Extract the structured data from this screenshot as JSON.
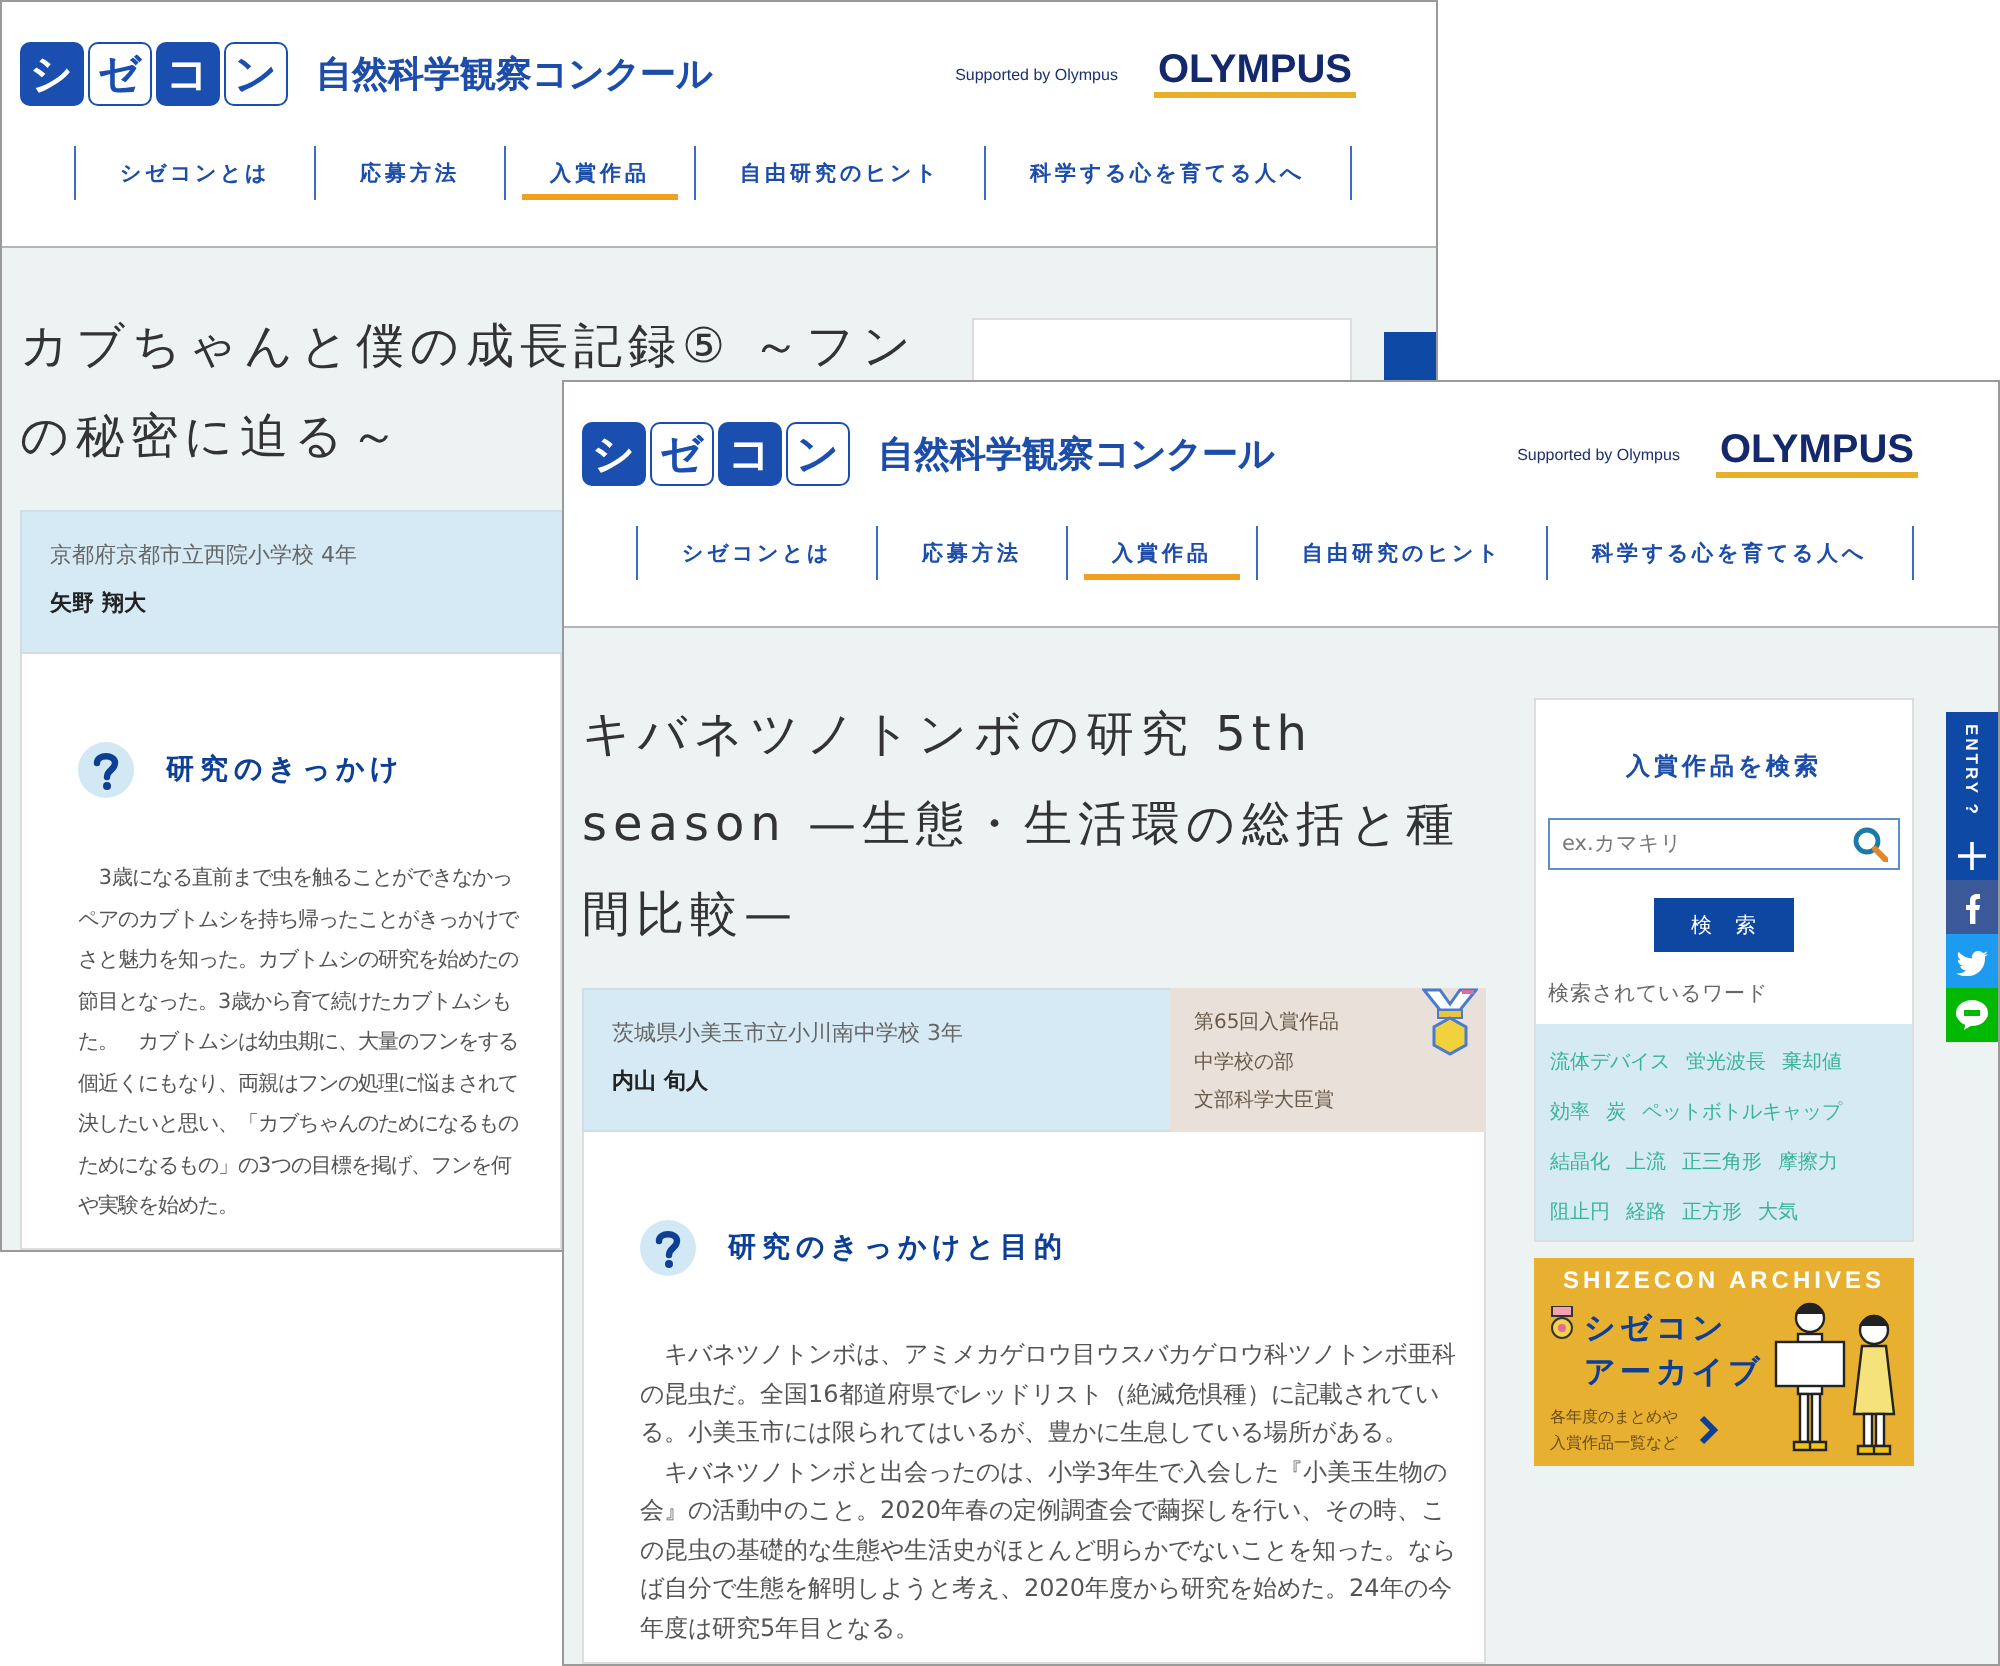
{
  "back_window": {
    "header": {
      "logo_boxes": [
        {
          "char": "シ",
          "filled": true
        },
        {
          "char": "ゼ",
          "filled": false
        },
        {
          "char": "コ",
          "filled": true
        },
        {
          "char": "ン",
          "filled": false
        }
      ],
      "site_name": "自然科学観察コンクール",
      "supported_by": "Supported by Olympus",
      "sponsor_logo": "OLYMPUS"
    },
    "nav": [
      {
        "label": "シゼコンとは",
        "selected": false
      },
      {
        "label": "応募方法",
        "selected": false
      },
      {
        "label": "入賞作品",
        "selected": true
      },
      {
        "label": "自由研究のヒント",
        "selected": false
      },
      {
        "label": "科学する心を育てる人へ",
        "selected": false
      }
    ],
    "title_lines": [
      "カブちゃんと僕の成長記録⑤ ～フン",
      "の秘密に迫る～"
    ],
    "student": {
      "school": "京都府京都市立西院小学校 4年",
      "name": "矢野 翔大"
    },
    "section": {
      "heading": "研究のきっかけ",
      "lines": [
        "3歳になる直前まで虫を触ることができなかっ",
        "ペアのカブトムシを持ち帰ったことがきっかけで",
        "さと魅力を知った。カブトムシの研究を始めたの",
        "節目となった。3歳から育て続けたカブトムシも",
        "た。　カブトムシは幼虫期に、大量のフンをする",
        "個近くにもなり、両親はフンの処理に悩まされて",
        "決したいと思い、「カブちゃんのためになるもの",
        "ためになるもの」の3つの目標を掲げ、フンを何",
        "や実験を始めた。"
      ]
    }
  },
  "front_window": {
    "header": {
      "logo_boxes": [
        {
          "char": "シ",
          "filled": true
        },
        {
          "char": "ゼ",
          "filled": false
        },
        {
          "char": "コ",
          "filled": true
        },
        {
          "char": "ン",
          "filled": false
        }
      ],
      "site_name": "自然科学観察コンクール",
      "supported_by": "Supported by Olympus",
      "sponsor_logo": "OLYMPUS"
    },
    "nav": [
      {
        "label": "シゼコンとは",
        "selected": false
      },
      {
        "label": "応募方法",
        "selected": false
      },
      {
        "label": "入賞作品",
        "selected": true
      },
      {
        "label": "自由研究のヒント",
        "selected": false
      },
      {
        "label": "科学する心を育てる人へ",
        "selected": false
      }
    ],
    "title_lines": [
      "キバネツノトンボの研究 5th",
      "season —生態・生活環の総括と種",
      "間比較—"
    ],
    "student": {
      "school": "茨城県小美玉市立小川南中学校 3年",
      "name": "内山 旬人"
    },
    "award": {
      "lines": [
        "第65回入賞作品",
        "中学校の部",
        "文部科学大臣賞"
      ]
    },
    "section": {
      "heading": "研究のきっかけと目的",
      "paragraphs": [
        "キバネツノトンボは、アミメカゲロウ目ウスバカゲロウ科ツノトンボ亜科の昆虫だ。全国16都道府県でレッドリスト（絶滅危惧種）に記載されている。小美玉市には限られてはいるが、豊かに生息している場所がある。",
        "キバネツノトンボと出会ったのは、小学3年生で入会した『小美玉生物の会』の活動中のこと。2020年春の定例調査会で繭探しを行い、その時、この昆虫の基礎的な生態や生活史がほとんど明らかでないことを知った。ならば自分で生態を解明しようと考え、2020年度から研究を始めた。24年の今年度は研究5年目となる。"
      ]
    },
    "sidebar": {
      "search_title": "入賞作品を検索",
      "search": {
        "placeholder": "ex.カマキリ"
      },
      "search_button": "検　索",
      "words_label": "検索されているワード",
      "words": [
        "流体デバイス",
        "蛍光波長",
        "棄却値",
        "効率",
        "炭",
        "ペットボトルキャップ",
        "結晶化",
        "上流",
        "正三角形",
        "摩擦力",
        "阻止円",
        "経路",
        "正方形",
        "大気"
      ],
      "archive": {
        "heading": "SHIZECON ARCHIVES",
        "title_lines": [
          "シゼコン",
          "アーカイブ"
        ],
        "note_lines": [
          "各年度のまとめや",
          "入賞作品一覧など"
        ]
      }
    },
    "share": {
      "entry_label": "ENTRY ?"
    }
  }
}
